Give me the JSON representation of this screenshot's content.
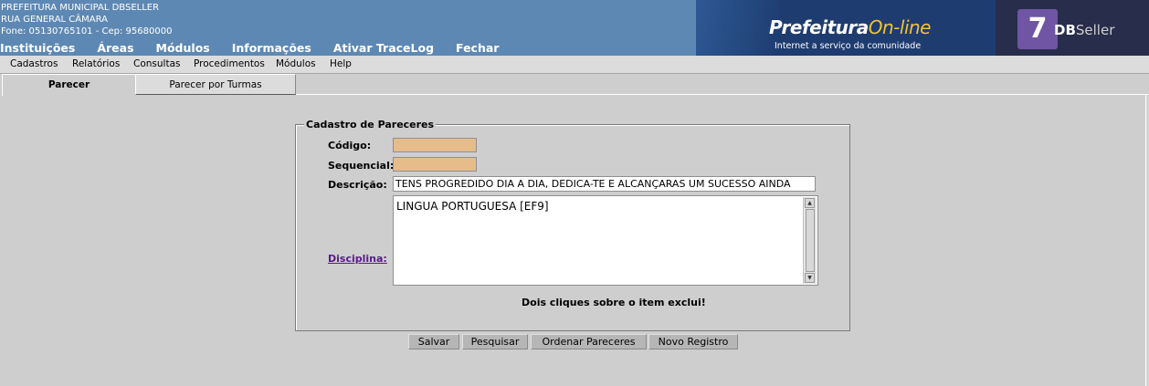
{
  "header": {
    "lines": [
      "PREFEITURA MUNICIPAL DBSELLER",
      "RUA GENERAL CÂMARA",
      "Fone: 05130765101  -  Cep: 95680000"
    ],
    "nav": [
      "Instituições",
      "Áreas",
      "Módulos",
      "Informações",
      "Ativar TraceLog",
      "Fechar"
    ],
    "banner": {
      "brand": "Prefeitura",
      "brand_suffix": "On-line",
      "tagline": "Internet a serviço da comunidade",
      "logo_db": "DB",
      "logo_seller": "Seller"
    }
  },
  "menu": [
    "Cadastros",
    "Relatórios",
    "Consultas",
    "Procedimentos",
    "Módulos",
    "Help"
  ],
  "tabs": [
    {
      "label": "Parecer",
      "active": true
    },
    {
      "label": "Parecer por Turmas",
      "active": false
    }
  ],
  "form": {
    "legend": "Cadastro de Pareceres",
    "codigo_label": "Código:",
    "codigo_value": "",
    "sequencial_label": "Sequencial:",
    "sequencial_value": "",
    "descricao_label": "Descrição:",
    "descricao_value": "TENS PROGREDIDO DIA A DIA, DEDICA-TE E ALCANÇARAS UM SUCESSO AINDA",
    "disciplina_label": "Disciplina:",
    "disciplinas": [
      "LINGUA PORTUGUESA [EF9]"
    ],
    "hint": "Dois cliques sobre o item exclui!"
  },
  "buttons": [
    "Salvar",
    "Pesquisar",
    "Ordenar Pareceres",
    "Novo Registro"
  ],
  "colors": {
    "header_bg": "#5e88b4",
    "banner_bg": "#1e3c70",
    "readonly_field": "#e6bc8b",
    "link": "#5a1a8a"
  }
}
